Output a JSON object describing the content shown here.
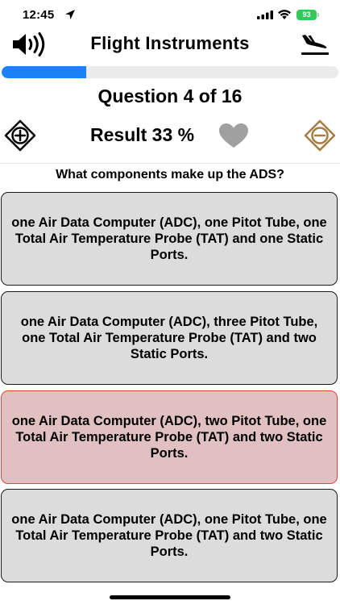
{
  "status_bar": {
    "time": "12:45",
    "battery": "93"
  },
  "nav": {
    "title": "Flight Instruments",
    "left_icon": "speaker-icon",
    "right_icon": "airplane-landing-icon"
  },
  "progress": {
    "fraction": 0.25,
    "color": "#1a82f5"
  },
  "question_counter": "Question 4 of 16",
  "result": {
    "label": "Result 33 %",
    "heart_color": "#a0a0a0",
    "plus_icon": "plus-circle-icon",
    "minus_icon": "minus-circle-icon",
    "minus_color": "#a57c45"
  },
  "question": "What components make up the ADS?",
  "answers": [
    {
      "text": "one Air Data Computer (ADC), one Pitot Tube, one Total Air Temperature Probe (TAT) and one Static Ports.",
      "state": "neutral"
    },
    {
      "text": "one Air Data Computer (ADC), three Pitot Tube, one Total Air Temperature Probe (TAT) and two Static Ports.",
      "state": "neutral"
    },
    {
      "text": "one Air Data Computer (ADC), two Pitot Tube, one Total Air Temperature Probe (TAT) and two Static Ports.",
      "state": "wrong"
    },
    {
      "text": "one Air Data Computer (ADC), one Pitot Tube, one Total Air Temperature Probe (TAT) and two Static Ports.",
      "state": "neutral"
    }
  ],
  "colors": {
    "answer_bg": "#dcdcdc",
    "wrong_bg": "#e0c0c0",
    "wrong_border": "#e0453f"
  }
}
